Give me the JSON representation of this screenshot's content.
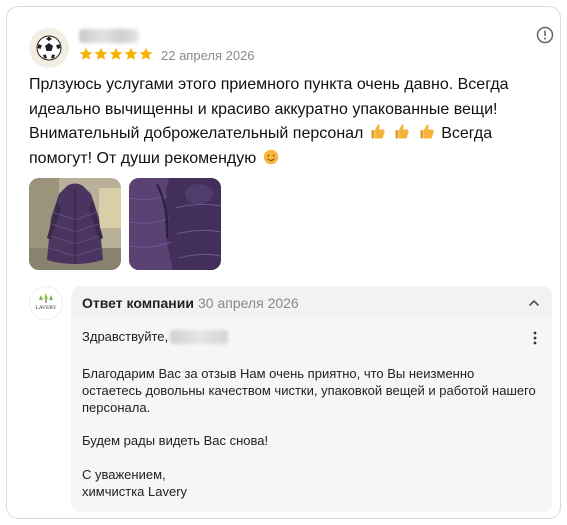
{
  "review": {
    "date": "22 апреля 2026",
    "rating": 5,
    "text_part1": "Прлзуюсь услугами этого приемного пункта очень давно. Всегда идеально вычищенны и красиво аккуратно упакованные вещи! Внимательный доброжелательный персонал",
    "text_part2": "Всегда помогут! От души рекомендую",
    "photos": [
      "coat-photo-front",
      "coat-photo-closeup"
    ]
  },
  "company_reply": {
    "title": "Ответ компании",
    "date": "30 апреля 2026",
    "logo_text": "LAVERY",
    "greeting": "Здравствуйте,",
    "paragraph1": "Благодарим Вас за отзыв Нам очень приятно, что Вы неизменно остаетесь довольны качеством чистки, упаковкой вещей и работой нашего персонала.",
    "paragraph2": "Будем рады видеть Вас снова!",
    "signature": "С уважением,\nхимчистка Lavery"
  },
  "icons": {
    "info": "info-circle-icon",
    "collapse": "chevron-up-icon",
    "more": "kebab-menu-icon"
  },
  "colors": {
    "star": "#f6b301",
    "muted_text": "#8a8a8a",
    "reply_bg": "#f2f2f2",
    "coat": "#4a3560"
  }
}
